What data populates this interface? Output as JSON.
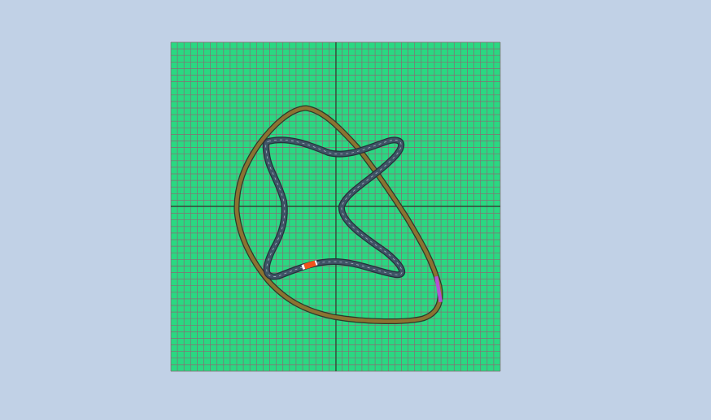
{
  "scene": {
    "background_color": "#c1d1e6",
    "field_color": "#2ad882",
    "grid_line_color": "#8a6b73",
    "axis_color": "#1d4a2c",
    "grid_divisions": 50
  },
  "outer_track": {
    "color": "#8b7331",
    "border_color": "#2b3a2a"
  },
  "inner_track": {
    "color": "#3f5466",
    "border_color": "#24303a",
    "dash_color": "#a8b6c2"
  },
  "cars": [
    {
      "name": "orange-car",
      "color": "#f0541c",
      "track": "inner"
    },
    {
      "name": "purple-car",
      "color": "#b44fd6",
      "track": "outer"
    }
  ]
}
